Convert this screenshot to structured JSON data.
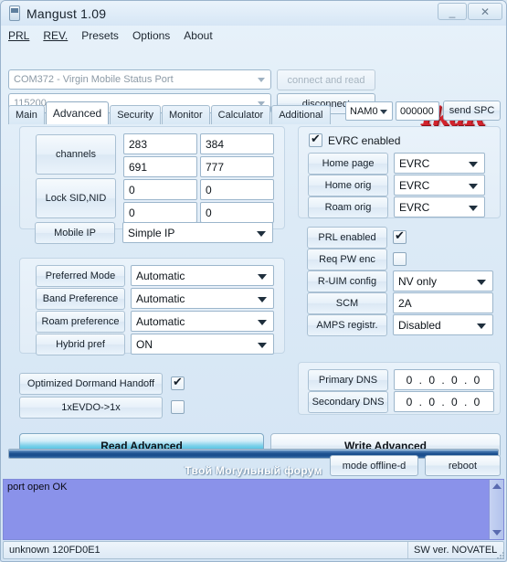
{
  "window": {
    "title": "Mangust 1.09",
    "icon": "phone-icon",
    "minimize": "_",
    "close": "✕"
  },
  "menu": [
    "PRL",
    "REV.",
    "Presets",
    "Options",
    "About"
  ],
  "connection": {
    "port_value": "COM372 - Virgin Mobile Status Port",
    "baud_value": "115200",
    "connect_label": "connect and read",
    "disconnect_label": "disconnect"
  },
  "brand": {
    "logo_text": "IkaR",
    "logo_color": "#d2222c"
  },
  "tabs": [
    {
      "label": "Main",
      "active": false
    },
    {
      "label": "Advanced",
      "active": true
    },
    {
      "label": "Security",
      "active": false
    },
    {
      "label": "Monitor",
      "active": false
    },
    {
      "label": "Calculator",
      "active": false
    },
    {
      "label": "Additional",
      "active": false
    }
  ],
  "nam": {
    "selected": "NAM0",
    "spc_value": "000000",
    "send_label": "send SPC"
  },
  "left": {
    "channels_label": "channels",
    "channels": [
      "283",
      "384",
      "691",
      "777"
    ],
    "lock_label": "Lock SID,NID",
    "lock": [
      "0",
      "0",
      "0",
      "0"
    ],
    "mobile_ip_label": "Mobile IP",
    "mobile_ip_value": "Simple IP",
    "prefs": [
      {
        "label": "Preferred Mode",
        "value": "Automatic"
      },
      {
        "label": "Band Preference",
        "value": "Automatic"
      },
      {
        "label": "Roam preference",
        "value": "Automatic"
      },
      {
        "label": "Hybrid pref",
        "value": "ON"
      }
    ],
    "odh_label": "Optimized Dormand Handoff",
    "odh_checked": true,
    "evdo_label": "1xEVDO->1x",
    "evdo_checked": false
  },
  "right": {
    "evrc_enabled_label": "EVRC enabled",
    "evrc_enabled_checked": true,
    "evrc_rows": [
      {
        "label": "Home page",
        "value": "EVRC"
      },
      {
        "label": "Home orig",
        "value": "EVRC"
      },
      {
        "label": "Roam orig",
        "value": "EVRC"
      }
    ],
    "prl_label": "PRL enabled",
    "prl_checked": true,
    "reqpw_label": "Req PW enc",
    "reqpw_checked": false,
    "ruim_label": "R-UIM config",
    "ruim_value": "NV only",
    "scm_label": "SCM",
    "scm_value": "2A",
    "amps_label": "AMPS registr.",
    "amps_value": "Disabled",
    "dns": [
      {
        "label": "Primary DNS",
        "value": "0 . 0 . 0 . 0"
      },
      {
        "label": "Secondary DNS",
        "value": "0 . 0 . 0 . 0"
      }
    ]
  },
  "actions": {
    "read_label": "Read Advanced",
    "write_label": "Write Advanced"
  },
  "footer": {
    "forum_text": "Твой Могульный форум",
    "mode_label": "mode offline-d",
    "reboot_label": "reboot",
    "progress_percent": 100
  },
  "log": {
    "lines": "port open OK"
  },
  "status": {
    "left": "unknown 120FD0E1",
    "right": "SW ver. NOVATEL"
  }
}
